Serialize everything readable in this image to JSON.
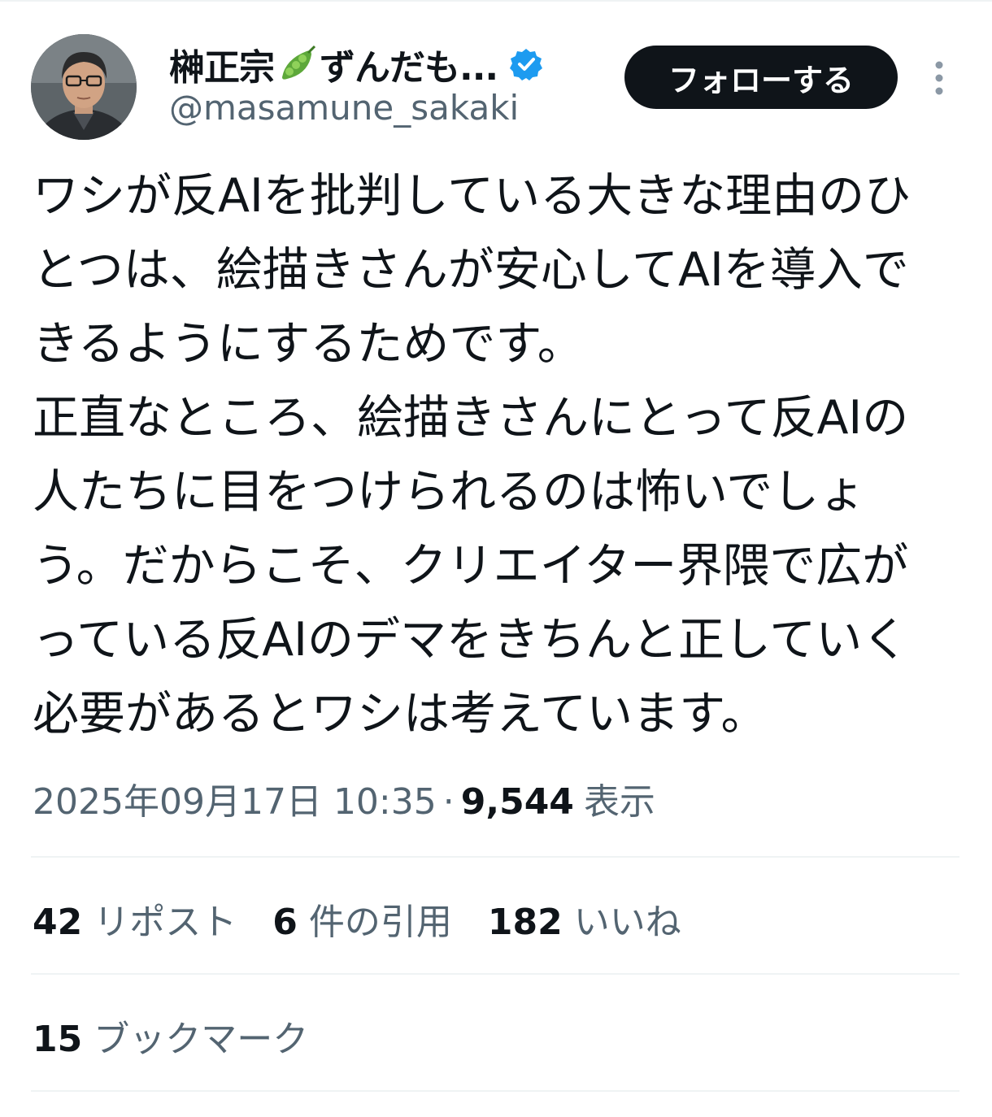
{
  "author": {
    "display_name": "榊正宗",
    "display_name_suffix": "ずんだも...",
    "handle": "@masamune_sakaki",
    "verified": true
  },
  "follow_button_label": "フォローする",
  "tweet": {
    "lines": [
      "ワシが反AIを批判している大きな理由のひ",
      "とつは、絵描きさんが安心してAIを導入で",
      "きるようにするためです。",
      "正直なところ、絵描きさんにとって反AIの",
      "人たちに目をつけられるのは怖いでしょ",
      "う。だからこそ、クリエイター界隈で広が",
      "っている反AIのデマをきちんと正していく",
      "必要があるとワシは考えています。"
    ]
  },
  "meta": {
    "timestamp": "2025年09月17日 10:35",
    "separator": "·",
    "views_count": "9,544",
    "views_label": "表示"
  },
  "stats": {
    "reposts_count": "42",
    "reposts_label": "リポスト",
    "quotes_count": "6",
    "quotes_label": "件の引用",
    "likes_count": "182",
    "likes_label": "いいね",
    "bookmarks_count": "15",
    "bookmarks_label": "ブックマーク"
  },
  "icons": {
    "avatar": "avatar-photo",
    "name_emoji": "pea-pod-icon",
    "verified": "verified-badge-icon",
    "more": "more-vertical-icon"
  },
  "colors": {
    "text_primary": "#0f1419",
    "text_secondary": "#536471",
    "verified_blue": "#1d9bf0",
    "follow_button_bg": "#0f1419",
    "divider": "#eff3f4"
  }
}
